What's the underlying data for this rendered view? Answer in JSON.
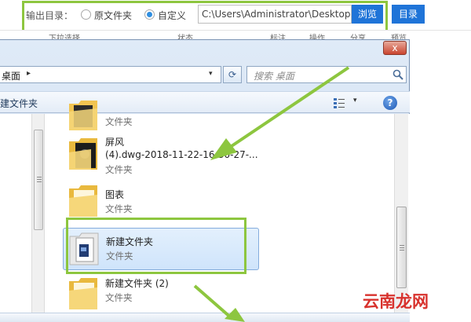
{
  "output_bar": {
    "label": "输出目录：",
    "option_source": "原文件夹",
    "option_custom": "自定义",
    "path_value": "C:\\Users\\Administrator\\Desktop",
    "browse_label": "浏览",
    "dir_label": "目录",
    "selected_option": "custom"
  },
  "background_columns": [
    "下拉选择",
    "状态",
    "标注",
    "操作",
    "分享",
    "预览"
  ],
  "dialog": {
    "close_symbol": "x",
    "address": {
      "location": "桌面",
      "separator": "▸",
      "dropdown": "▾"
    },
    "refresh_symbol": "⟳",
    "search_placeholder": "搜索 桌面",
    "toolbar": {
      "new_folder": "建文件夹",
      "help_symbol": "?"
    },
    "items": [
      {
        "name": "",
        "type": "文件夹",
        "thumb": "dark"
      },
      {
        "name": "屏风",
        "name2": "(4).dwg-2018-11-22-16-30-27-...",
        "type": "文件夹",
        "thumb": "dark"
      },
      {
        "name": "图表",
        "type": "文件夹",
        "thumb": "plain"
      },
      {
        "name": "新建文件夹",
        "type": "文件夹",
        "thumb": "doc",
        "selected": true
      },
      {
        "name": "新建文件夹 (2)",
        "type": "文件夹",
        "thumb": "plain"
      }
    ]
  },
  "watermark": "云南龙网",
  "colors": {
    "accent_blue": "#1f74d8",
    "highlight_green": "#8dc63f",
    "selection": "#cfe4fb",
    "watermark_red": "#d8322d"
  }
}
